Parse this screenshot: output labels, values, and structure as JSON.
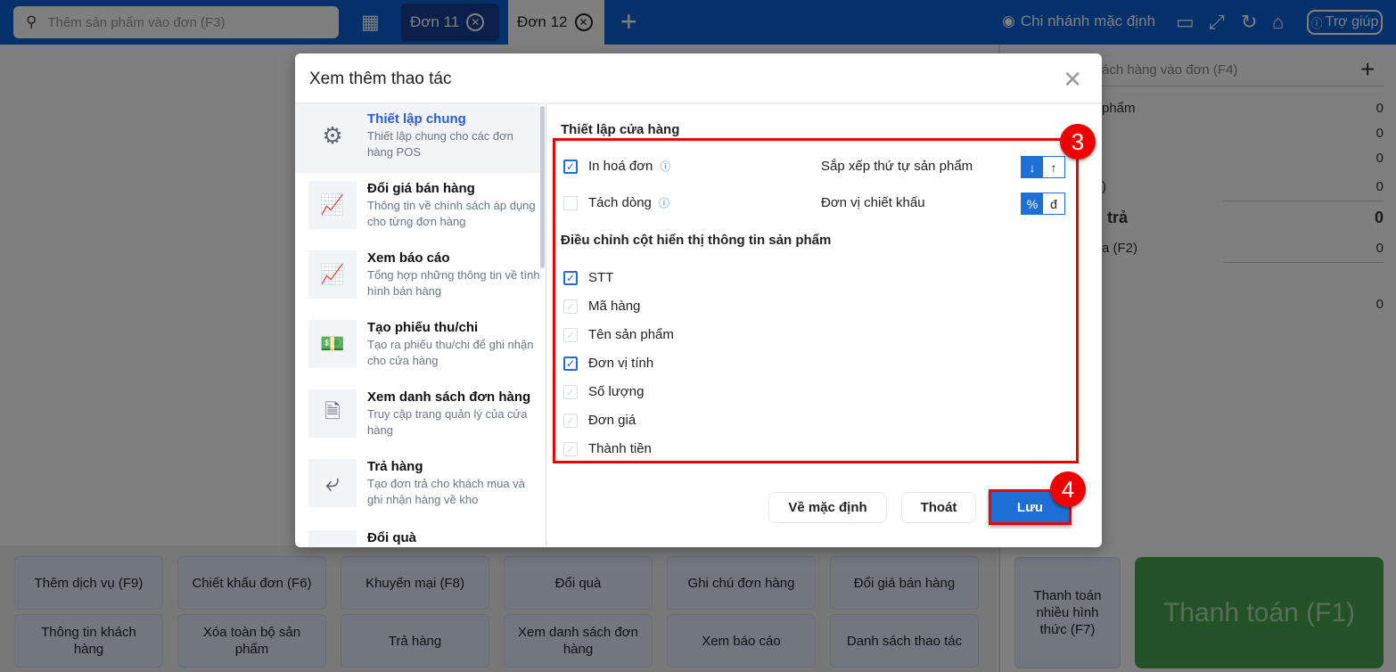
{
  "header": {
    "search_placeholder": "Thêm sản phẩm vào đơn (F3)",
    "tabs": [
      {
        "label": "Đơn 11"
      },
      {
        "label": "Đơn 12"
      }
    ],
    "branch": "Chi nhánh mặc định",
    "help": "Trợ giúp"
  },
  "right_panel": {
    "customer_placeholder": "ách hàng vào đơn (F4)",
    "rows": [
      {
        "label": "phẩm",
        "value": "0"
      },
      {
        "label": "",
        "value": "0"
      },
      {
        "label": "",
        "value": "0"
      },
      {
        "label": ")",
        "value": "0"
      },
      {
        "label": "trả",
        "value": "0"
      },
      {
        "label": "a (F2)",
        "value": "0"
      },
      {
        "label": "",
        "value": "0"
      }
    ]
  },
  "bottom": {
    "buttons": [
      "Thêm dịch vụ (F9)",
      "Chiết khấu đơn (F6)",
      "Khuyến mại (F8)",
      "Đổi quà",
      "Ghi chú đơn hàng",
      "Đổi giá bán hàng",
      "Thông tin khách hàng",
      "Xóa toàn bộ sản phẩm",
      "Trả hàng",
      "Xem danh sách đơn hàng",
      "Xem báo cáo",
      "Danh sách thao tác"
    ],
    "multi_pay": "Thanh toán nhiều hình thức (F7)",
    "pay": "Thanh toán (F1)"
  },
  "modal": {
    "title": "Xem thêm thao tác",
    "menu": [
      {
        "title": "Thiết lập chung",
        "desc": "Thiết lập chung cho các đơn hàng POS",
        "icon": "gears-icon"
      },
      {
        "title": "Đổi giá bán hàng",
        "desc": "Thông tin về chính sách áp dụng cho từng đơn hàng",
        "icon": "chart-icon"
      },
      {
        "title": "Xem báo cáo",
        "desc": "Tổng hợp những thông tin về tình hình bán hàng",
        "icon": "chart-icon"
      },
      {
        "title": "Tạo phiếu thu/chi",
        "desc": "Tạo ra phiếu thu/chi để ghi nhận cho cửa hàng",
        "icon": "money-icon"
      },
      {
        "title": "Xem danh sách đơn hàng",
        "desc": "Truy cập trang quản lý của cửa hàng",
        "icon": "invoice-icon"
      },
      {
        "title": "Trả hàng",
        "desc": "Tạo đơn trả cho khách mua và ghi nhận hàng về kho",
        "icon": "reply-icon"
      },
      {
        "title": "Đổi quà",
        "desc": "",
        "icon": "gift-icon"
      }
    ],
    "store_settings": "Thiết lập cửa hàng",
    "print_invoice": {
      "label": "In hoá đơn",
      "checked": true
    },
    "split_line": {
      "label": "Tách dòng",
      "checked": false
    },
    "sort_label": "Sắp xếp thứ tự sản phẩm",
    "sort_options": [
      "↓",
      "↑"
    ],
    "discount_label": "Đơn vị chiết khấu",
    "discount_options": [
      "%",
      "đ"
    ],
    "columns_title": "Điều chỉnh cột hiển thị thông tin sản phẩm",
    "columns": [
      {
        "label": "STT",
        "checked": true,
        "disabled": false
      },
      {
        "label": "Mã hàng",
        "checked": true,
        "disabled": true
      },
      {
        "label": "Tên sản phẩm",
        "checked": true,
        "disabled": true
      },
      {
        "label": "Đơn vị tính",
        "checked": true,
        "disabled": false
      },
      {
        "label": "Số lượng",
        "checked": true,
        "disabled": true
      },
      {
        "label": "Đơn giá",
        "checked": true,
        "disabled": true
      },
      {
        "label": "Thành tiền",
        "checked": true,
        "disabled": true
      }
    ],
    "reset": "Về mặc định",
    "exit": "Thoát",
    "save": "Lưu"
  },
  "annotations": {
    "step3": "3",
    "step4": "4",
    "color": "#ee0000"
  }
}
